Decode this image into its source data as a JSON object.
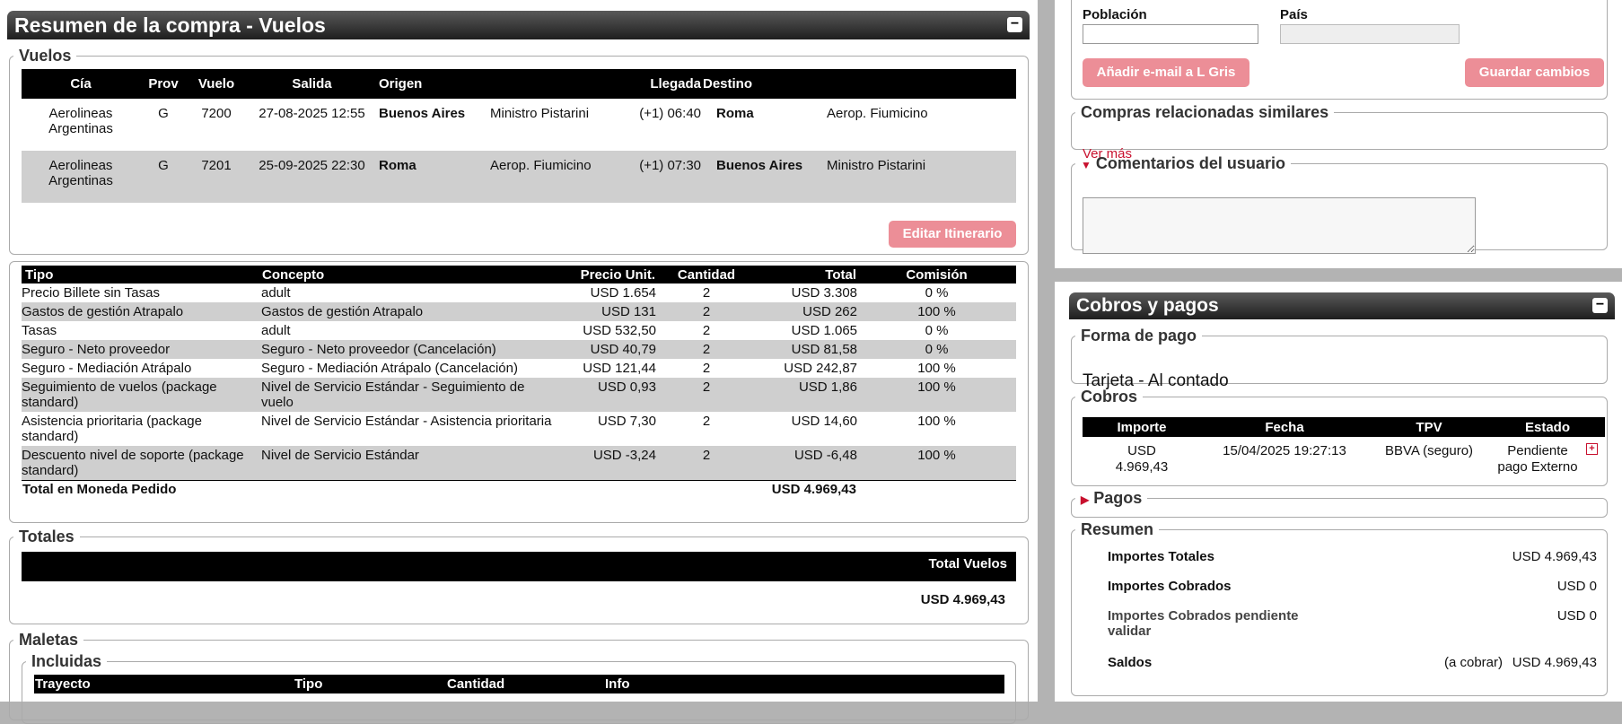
{
  "header": {
    "title": "Resumen de la compra - Vuelos",
    "min_icon": "−"
  },
  "vuelos": {
    "legend": "Vuelos",
    "columns": [
      "Cía",
      "Prov",
      "Vuelo",
      "Salida",
      "Origen",
      "Llegada",
      "Destino"
    ],
    "rows": [
      {
        "cia": "Aerolineas Argentinas",
        "prov": "G",
        "vuelo": "7200",
        "salida": "27-08-2025 12:55",
        "origen_city": "Buenos Aires",
        "origen_airport": "Ministro Pistarini",
        "llegada": "(+1) 06:40",
        "destino_city": "Roma",
        "destino_airport": "Aerop. Fiumicino"
      },
      {
        "cia": "Aerolineas Argentinas",
        "prov": "G",
        "vuelo": "7201",
        "salida": "25-09-2025 22:30",
        "origen_city": "Roma",
        "origen_airport": "Aerop. Fiumicino",
        "llegada": "(+1) 07:30",
        "destino_city": "Buenos Aires",
        "destino_airport": "Ministro Pistarini"
      }
    ],
    "edit_button": "Editar Itinerario"
  },
  "conceptos": {
    "columns": [
      "Tipo",
      "Concepto",
      "Precio Unit.",
      "Cantidad",
      "Total",
      "Comisión"
    ],
    "rows": [
      {
        "tipo": "Precio Billete sin Tasas",
        "concepto": "adult",
        "precio": "USD 1.654",
        "cantidad": "2",
        "total": "USD 3.308",
        "comision": "0 %"
      },
      {
        "tipo": "Gastos de gestión Atrapalo",
        "concepto": "Gastos de gestión Atrapalo",
        "precio": "USD 131",
        "cantidad": "2",
        "total": "USD 262",
        "comision": "100 %"
      },
      {
        "tipo": "Tasas",
        "concepto": "adult",
        "precio": "USD 532,50",
        "cantidad": "2",
        "total": "USD 1.065",
        "comision": "0 %"
      },
      {
        "tipo": "Seguro - Neto proveedor",
        "concepto": "Seguro - Neto proveedor (Cancelación)",
        "precio": "USD 40,79",
        "cantidad": "2",
        "total": "USD 81,58",
        "comision": "0 %"
      },
      {
        "tipo": "Seguro - Mediación Atrápalo",
        "concepto": "Seguro - Mediación Atrápalo (Cancelación)",
        "precio": "USD 121,44",
        "cantidad": "2",
        "total": "USD 242,87",
        "comision": "100 %"
      },
      {
        "tipo": "Seguimiento de vuelos (package standard)",
        "concepto": "Nivel de Servicio Estándar - Seguimiento de vuelo",
        "precio": "USD 0,93",
        "cantidad": "2",
        "total": "USD 1,86",
        "comision": "100 %"
      },
      {
        "tipo": "Asistencia prioritaria (package standard)",
        "concepto": "Nivel de Servicio Estándar - Asistencia prioritaria",
        "precio": "USD 7,30",
        "cantidad": "2",
        "total": "USD 14,60",
        "comision": "100 %"
      },
      {
        "tipo": "Descuento nivel de soporte (package standard)",
        "concepto": "Nivel de Servicio Estándar",
        "precio": "USD -3,24",
        "cantidad": "2",
        "total": "USD -6,48",
        "comision": "100 %"
      }
    ],
    "total_label": "Total en Moneda Pedido",
    "total_value": "USD 4.969,43"
  },
  "totales": {
    "legend": "Totales",
    "header": "Total Vuelos",
    "value": "USD 4.969,43"
  },
  "maletas": {
    "legend": "Maletas",
    "incluidas_legend": "Incluidas",
    "columns": [
      "Trayecto",
      "Tipo",
      "Cantidad",
      "Info"
    ]
  },
  "user": {
    "poblacion_label": "Población",
    "poblacion_value": "",
    "pais_label": "País",
    "pais_value": "",
    "email_button": "Añadir e-mail a L Gris",
    "save_button": "Guardar cambios"
  },
  "compras": {
    "legend": "Compras relacionadas similares",
    "link": "Ver más"
  },
  "comentarios": {
    "legend": "Comentarios del usuario",
    "value": ""
  },
  "cobros_panel": {
    "title": "Cobros y pagos",
    "min_icon": "−",
    "forma_legend": "Forma de pago",
    "forma_value": "Tarjeta - Al contado",
    "cobros_legend": "Cobros",
    "cobros_columns": [
      "Importe",
      "Fecha",
      "TPV",
      "Estado"
    ],
    "cobros_rows": [
      {
        "importe": "USD 4.969,43",
        "fecha": "15/04/2025 19:27:13",
        "tpv": "BBVA (seguro)",
        "estado": "Pendiente pago Externo"
      }
    ],
    "pagos_legend": "Pagos",
    "resumen_legend": "Resumen",
    "resumen_rows": [
      {
        "label": "Importes Totales",
        "extra": "",
        "value": "USD 4.969,43"
      },
      {
        "label": "Importes Cobrados",
        "extra": "",
        "value": "USD 0"
      },
      {
        "label": "Importes Cobrados pendiente validar",
        "extra": "",
        "value": "USD 0"
      },
      {
        "label": "Saldos",
        "extra": "(a cobrar)",
        "value": "USD 4.969,43"
      }
    ]
  },
  "colors": {
    "accent_button": "#ec8e97",
    "link": "#c8102e",
    "table_header": "#000000",
    "row_alt": "#cfcfcf"
  }
}
